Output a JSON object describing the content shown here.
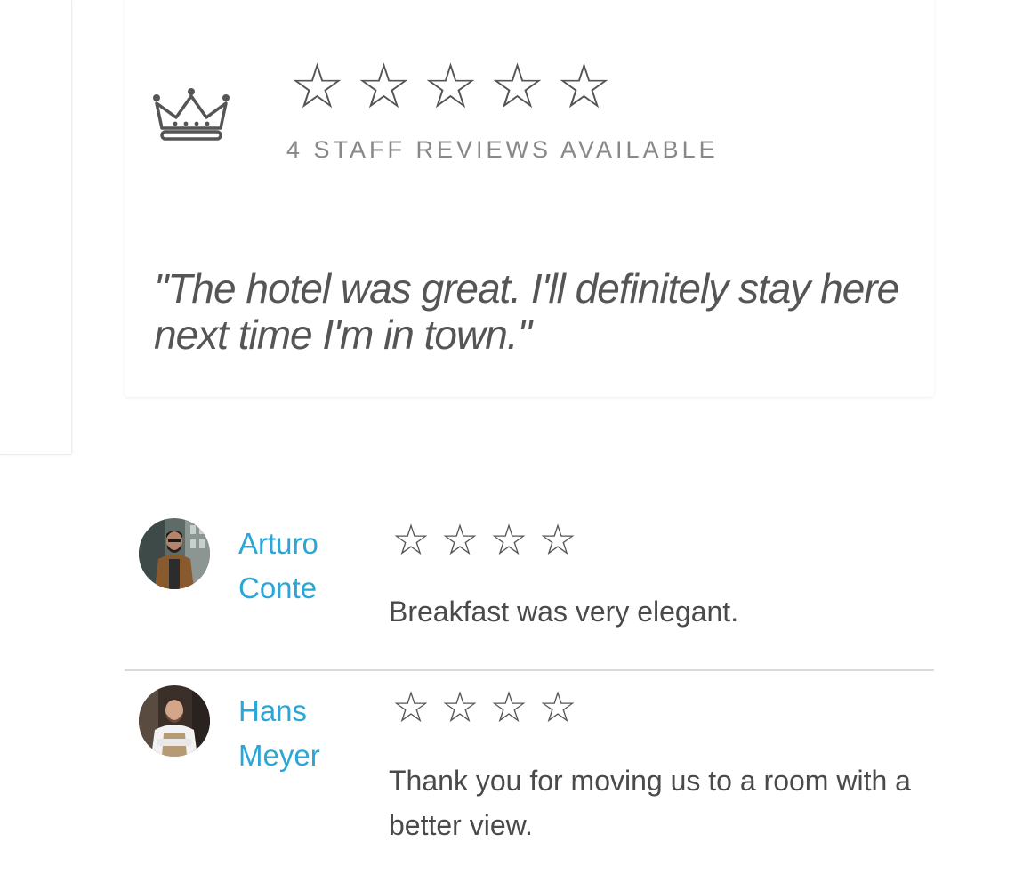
{
  "summary": {
    "icon": "crown-icon",
    "star_glyph": "☆",
    "star_count": 5,
    "review_count_label": "4 STAFF REVIEWS AVAILABLE",
    "quote": "\"The hotel was great. I'll definitely stay here next time I'm in town.\""
  },
  "reviews": [
    {
      "name": "Arturo Conte",
      "stars": [
        "☆",
        "☆",
        "☆",
        "☆"
      ],
      "text": "Breakfast was very elegant.",
      "avatar": "avatar-photo"
    },
    {
      "name": "Hans Meyer",
      "stars": [
        "☆",
        "☆",
        "☆",
        "☆"
      ],
      "text": "Thank you for moving us to a room with a better view.",
      "avatar": "avatar-photo"
    }
  ],
  "colors": {
    "link": "#2ba6d9",
    "text": "#4a4a4a",
    "muted": "#888888",
    "divider": "#dadada"
  }
}
